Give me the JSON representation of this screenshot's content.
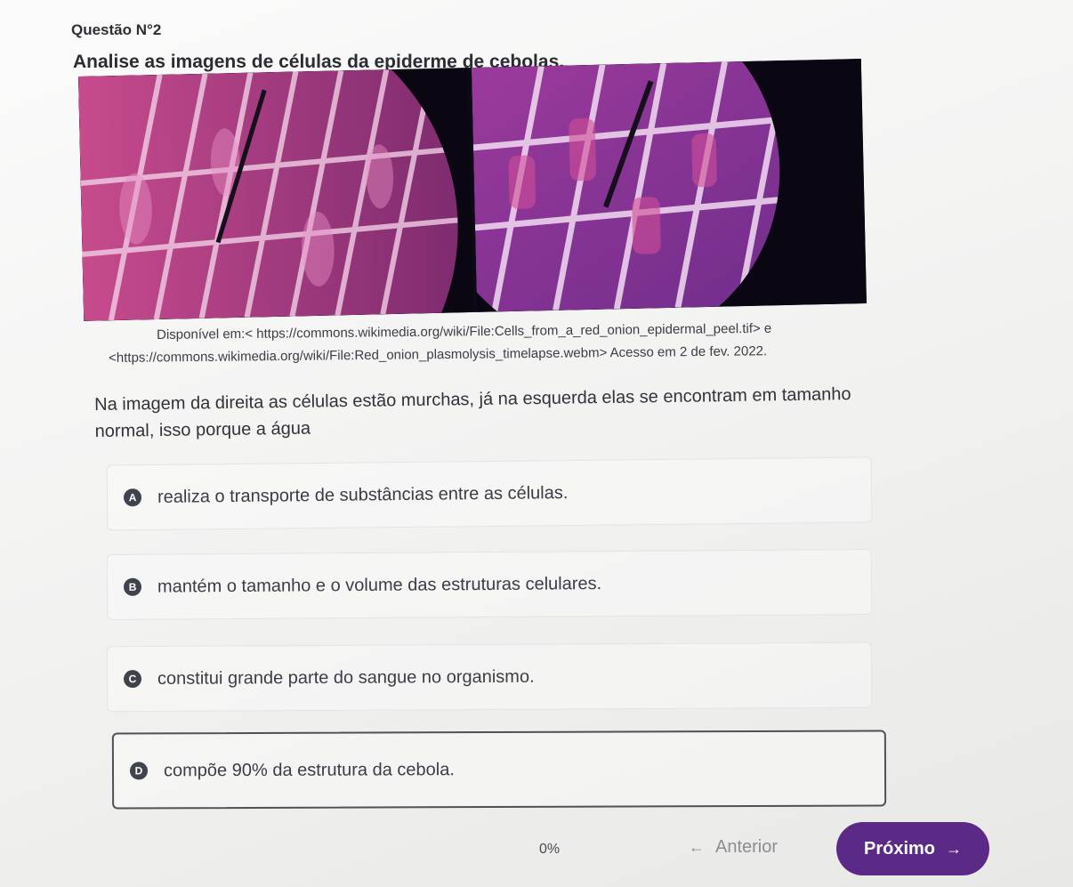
{
  "question": {
    "number_label": "Questão N°2",
    "prompt": "Analise as imagens de células da epiderme de cebolas.",
    "source_line_1": "Disponível em:< https://commons.wikimedia.org/wiki/File:Cells_from_a_red_onion_epidermal_peel.tif> e",
    "source_line_2": "<https://commons.wikimedia.org/wiki/File:Red_onion_plasmolysis_timelapse.webm> Acesso em 2 de fev. 2022.",
    "statement": "Na imagem da direita as células estão murchas, já na esquerda elas se encontram em tamanho normal, isso porque a água"
  },
  "figure": {
    "left_image": "red-onion-cells-normal",
    "right_image": "red-onion-cells-plasmolysis",
    "colors": {
      "background": "#0d0a18",
      "cell_magenta": "#b0347c",
      "cell_purple": "#7a2f8f",
      "cell_wall": "#f0d8f0"
    }
  },
  "options": [
    {
      "letter": "A",
      "text": "realiza o transporte de substâncias entre as células."
    },
    {
      "letter": "B",
      "text": "mantém o tamanho e o volume das estruturas celulares."
    },
    {
      "letter": "C",
      "text": "constitui grande parte do sangue no organismo."
    },
    {
      "letter": "D",
      "text": "compõe 90% da estrutura da cebola."
    }
  ],
  "selected_option": "D",
  "footer": {
    "progress": "0%",
    "previous_label": "Anterior",
    "next_label": "Próximo",
    "accent_color": "#5b2a86"
  }
}
